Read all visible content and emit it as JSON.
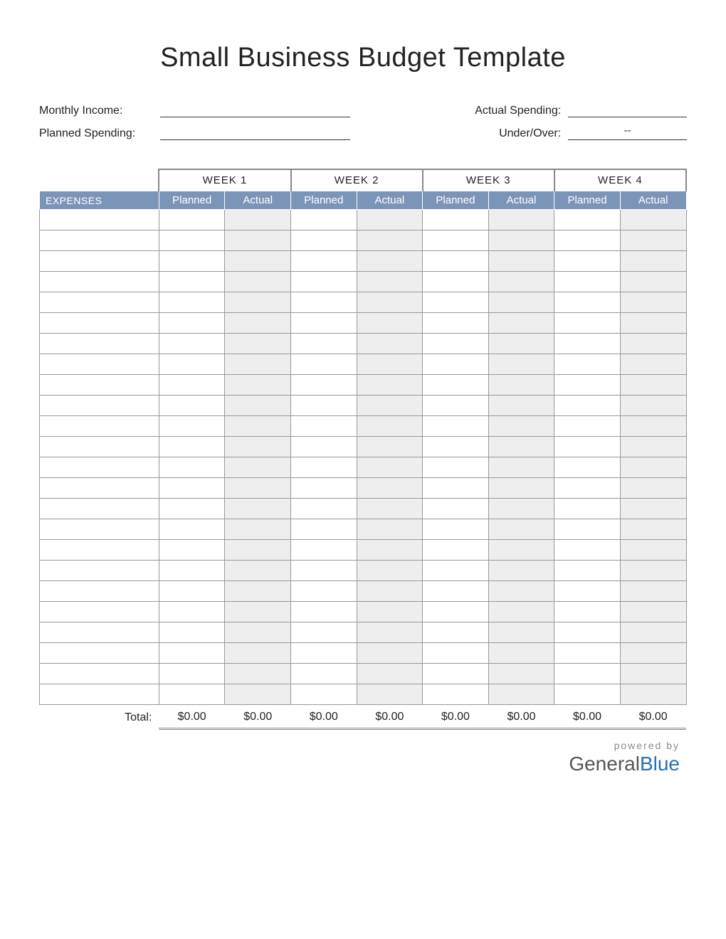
{
  "title": "Small Business Budget Template",
  "summary": {
    "monthly_income_label": "Monthly Income:",
    "monthly_income_value": "",
    "planned_spending_label": "Planned Spending:",
    "planned_spending_value": "",
    "actual_spending_label": "Actual Spending:",
    "actual_spending_value": "",
    "under_over_label": "Under/Over:",
    "under_over_value": "--"
  },
  "weeks": [
    "WEEK 1",
    "WEEK 2",
    "WEEK 3",
    "WEEK 4"
  ],
  "headers": {
    "expenses": "EXPENSES",
    "planned": "Planned",
    "actual": "Actual"
  },
  "row_count": 24,
  "totals": {
    "label": "Total:",
    "values": [
      "$0.00",
      "$0.00",
      "$0.00",
      "$0.00",
      "$0.00",
      "$0.00",
      "$0.00",
      "$0.00"
    ]
  },
  "footer": {
    "powered_by": "powered by",
    "brand_general": "General",
    "brand_blue": "Blue"
  }
}
